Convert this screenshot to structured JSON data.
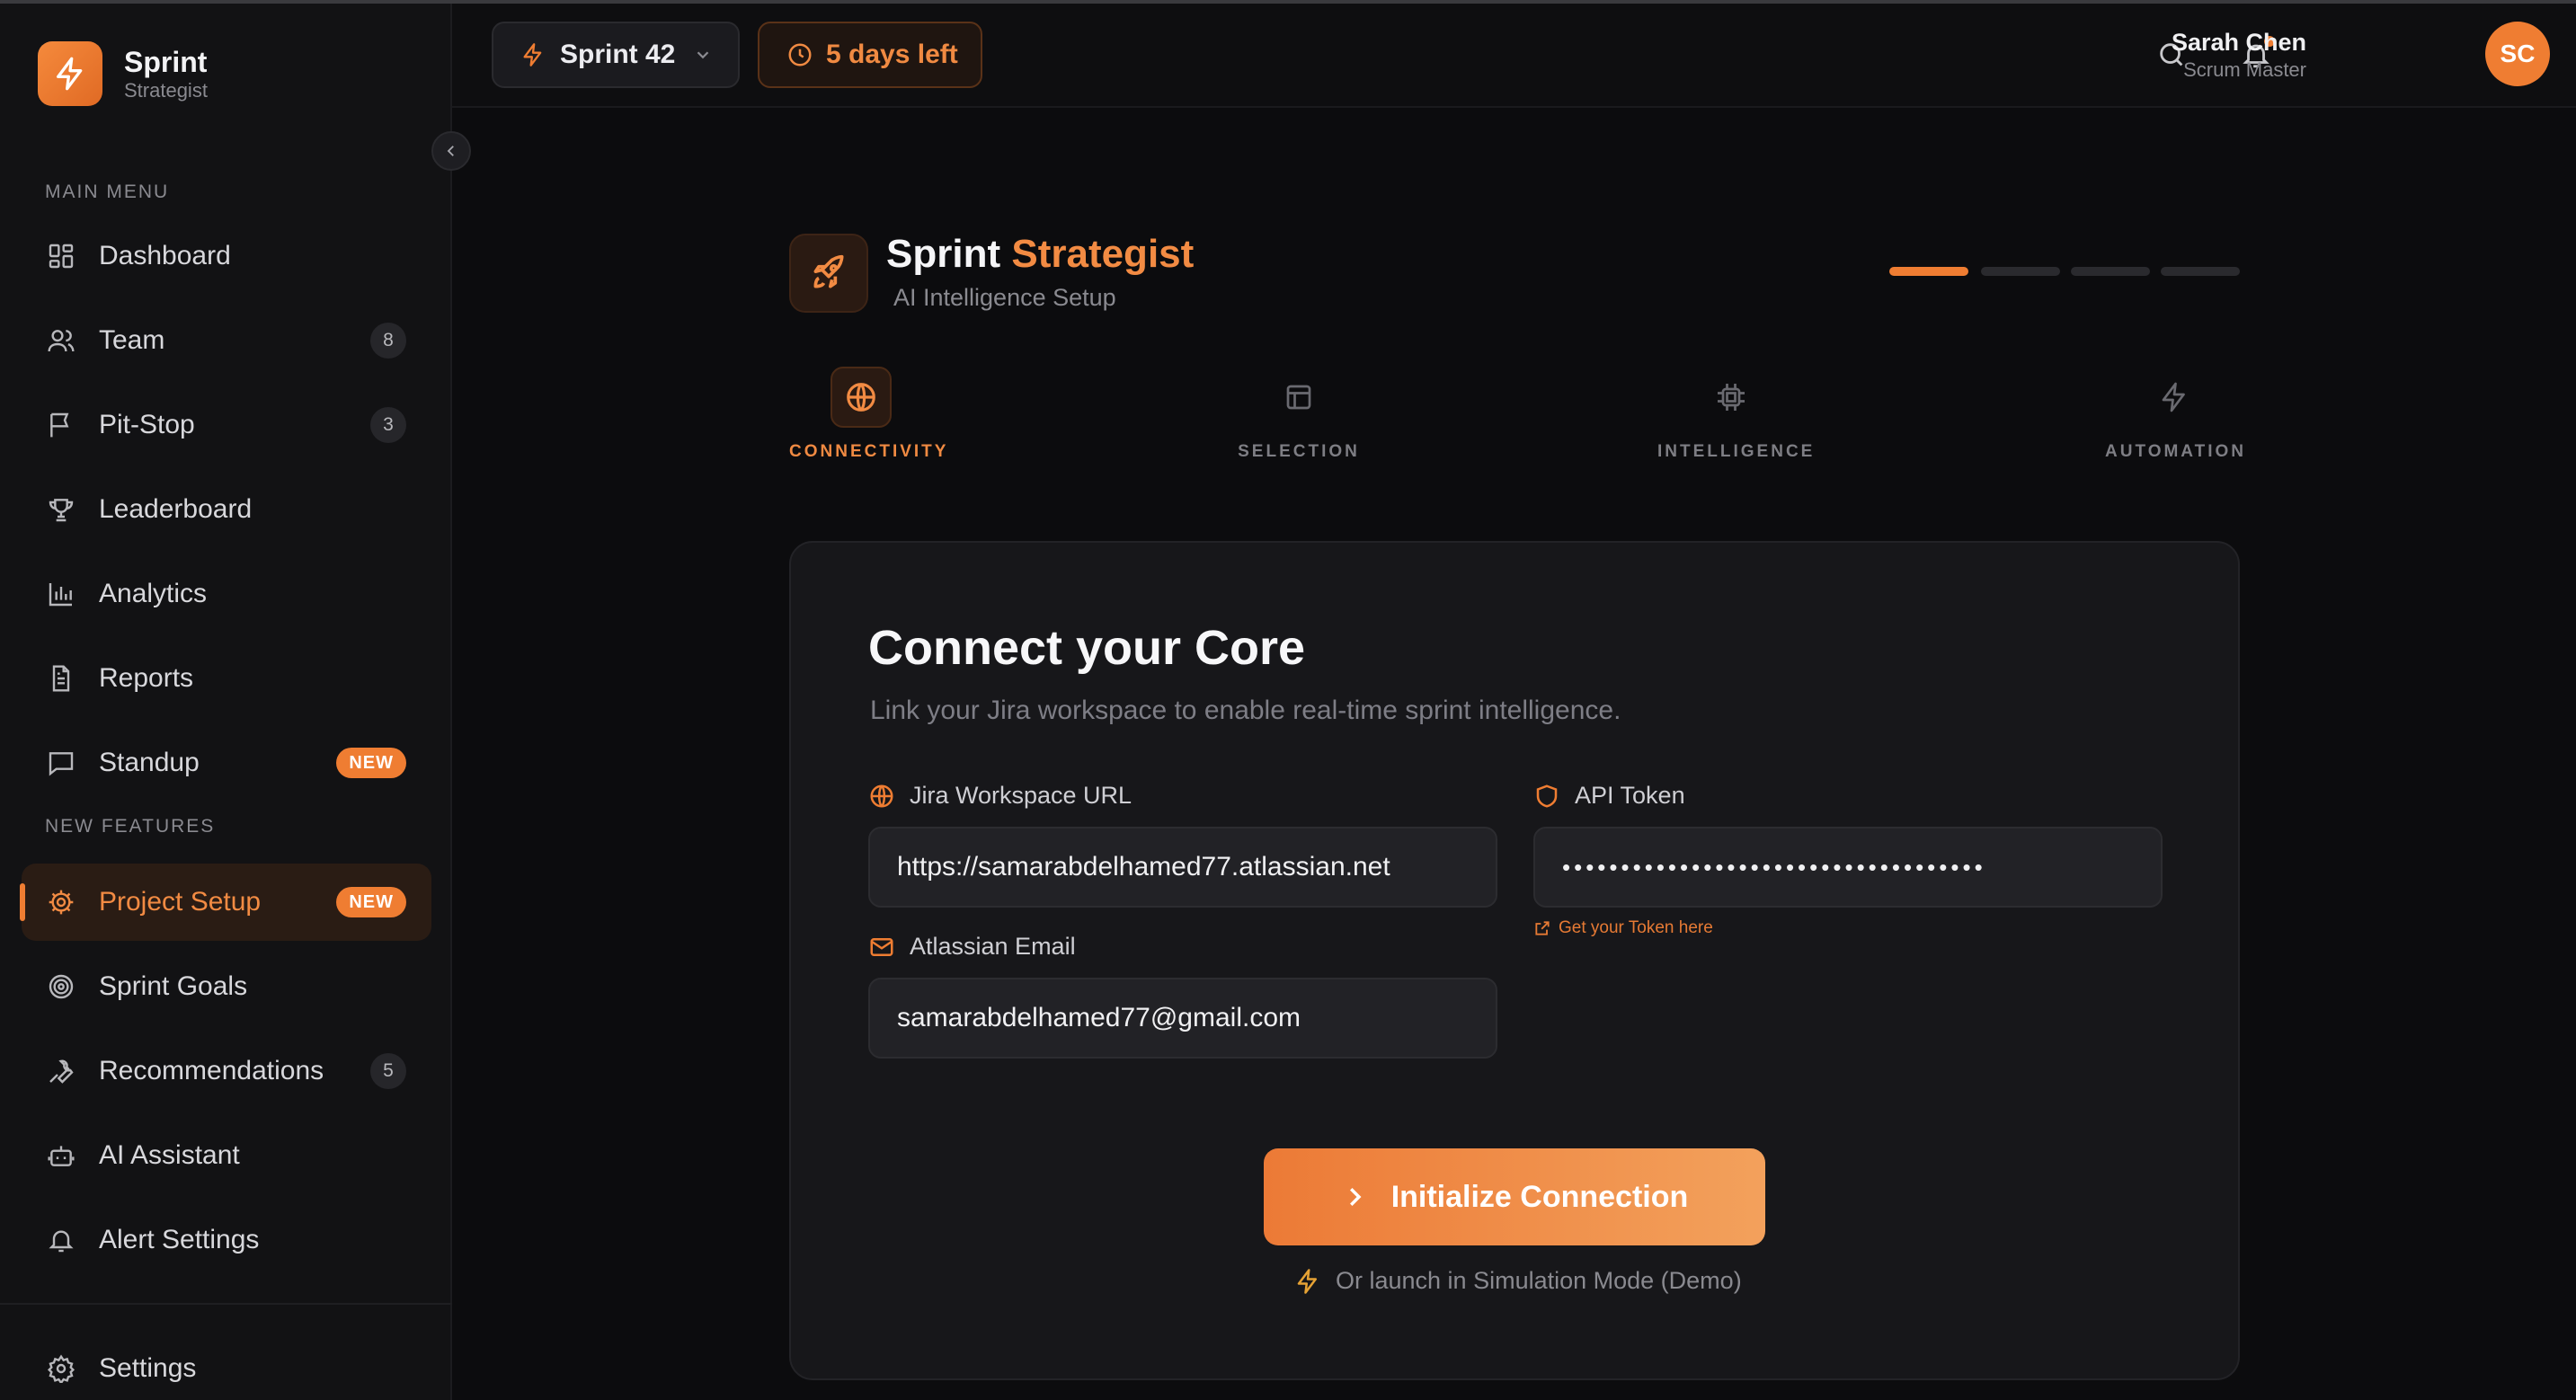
{
  "brand": {
    "name": "Sprint",
    "sub": "Strategist"
  },
  "sidebar": {
    "main_menu_label": "MAIN MENU",
    "new_features_label": "NEW FEATURES",
    "items": [
      {
        "label": "Dashboard",
        "icon": "dashboard-icon"
      },
      {
        "label": "Team",
        "icon": "users-icon",
        "count": "8"
      },
      {
        "label": "Pit-Stop",
        "icon": "flag-icon",
        "count": "3"
      },
      {
        "label": "Leaderboard",
        "icon": "trophy-icon"
      },
      {
        "label": "Analytics",
        "icon": "bar-chart-icon"
      },
      {
        "label": "Reports",
        "icon": "document-icon"
      },
      {
        "label": "Standup",
        "icon": "message-icon",
        "badge": "NEW"
      }
    ],
    "feature_items": [
      {
        "label": "Project Setup",
        "icon": "cog-icon",
        "badge": "NEW",
        "active": true
      },
      {
        "label": "Sprint Goals",
        "icon": "target-icon"
      },
      {
        "label": "Recommendations",
        "icon": "wrench-icon",
        "count": "5"
      },
      {
        "label": "AI Assistant",
        "icon": "bot-icon"
      },
      {
        "label": "Alert Settings",
        "icon": "bell-icon"
      }
    ],
    "settings_label": "Settings"
  },
  "header": {
    "sprint_label": "Sprint 42",
    "days_left": "5 days left",
    "user_name": "Sarah Chen",
    "user_role": "Scrum Master",
    "avatar_initials": "SC"
  },
  "setup": {
    "title_part1": "Sprint",
    "title_part2": "Strategist",
    "subtitle": "AI Intelligence Setup",
    "progress_step": 1,
    "progress_total": 4,
    "steps": [
      {
        "label": "CONNECTIVITY",
        "icon": "globe-icon",
        "active": true
      },
      {
        "label": "SELECTION",
        "icon": "layout-icon"
      },
      {
        "label": "INTELLIGENCE",
        "icon": "cpu-icon"
      },
      {
        "label": "AUTOMATION",
        "icon": "bolt-icon"
      }
    ]
  },
  "card": {
    "title": "Connect your Core",
    "subtitle": "Link your Jira workspace to enable real-time sprint intelligence.",
    "jira_url_label": "Jira Workspace URL",
    "jira_url_value": "https://samarabdelhamed77.atlassian.net",
    "api_token_label": "API Token",
    "api_token_value": "••••••••••••••••••••••••••••••••••••",
    "token_link": "Get your Token here",
    "email_label": "Atlassian Email",
    "email_value": "samarabdelhamed77@gmail.com",
    "init_button": "Initialize Connection",
    "sim_link": "Or launch in Simulation Mode (Demo)"
  },
  "colors": {
    "accent": "#ef7d32",
    "background": "#0c0c0e",
    "card": "#17171a"
  }
}
